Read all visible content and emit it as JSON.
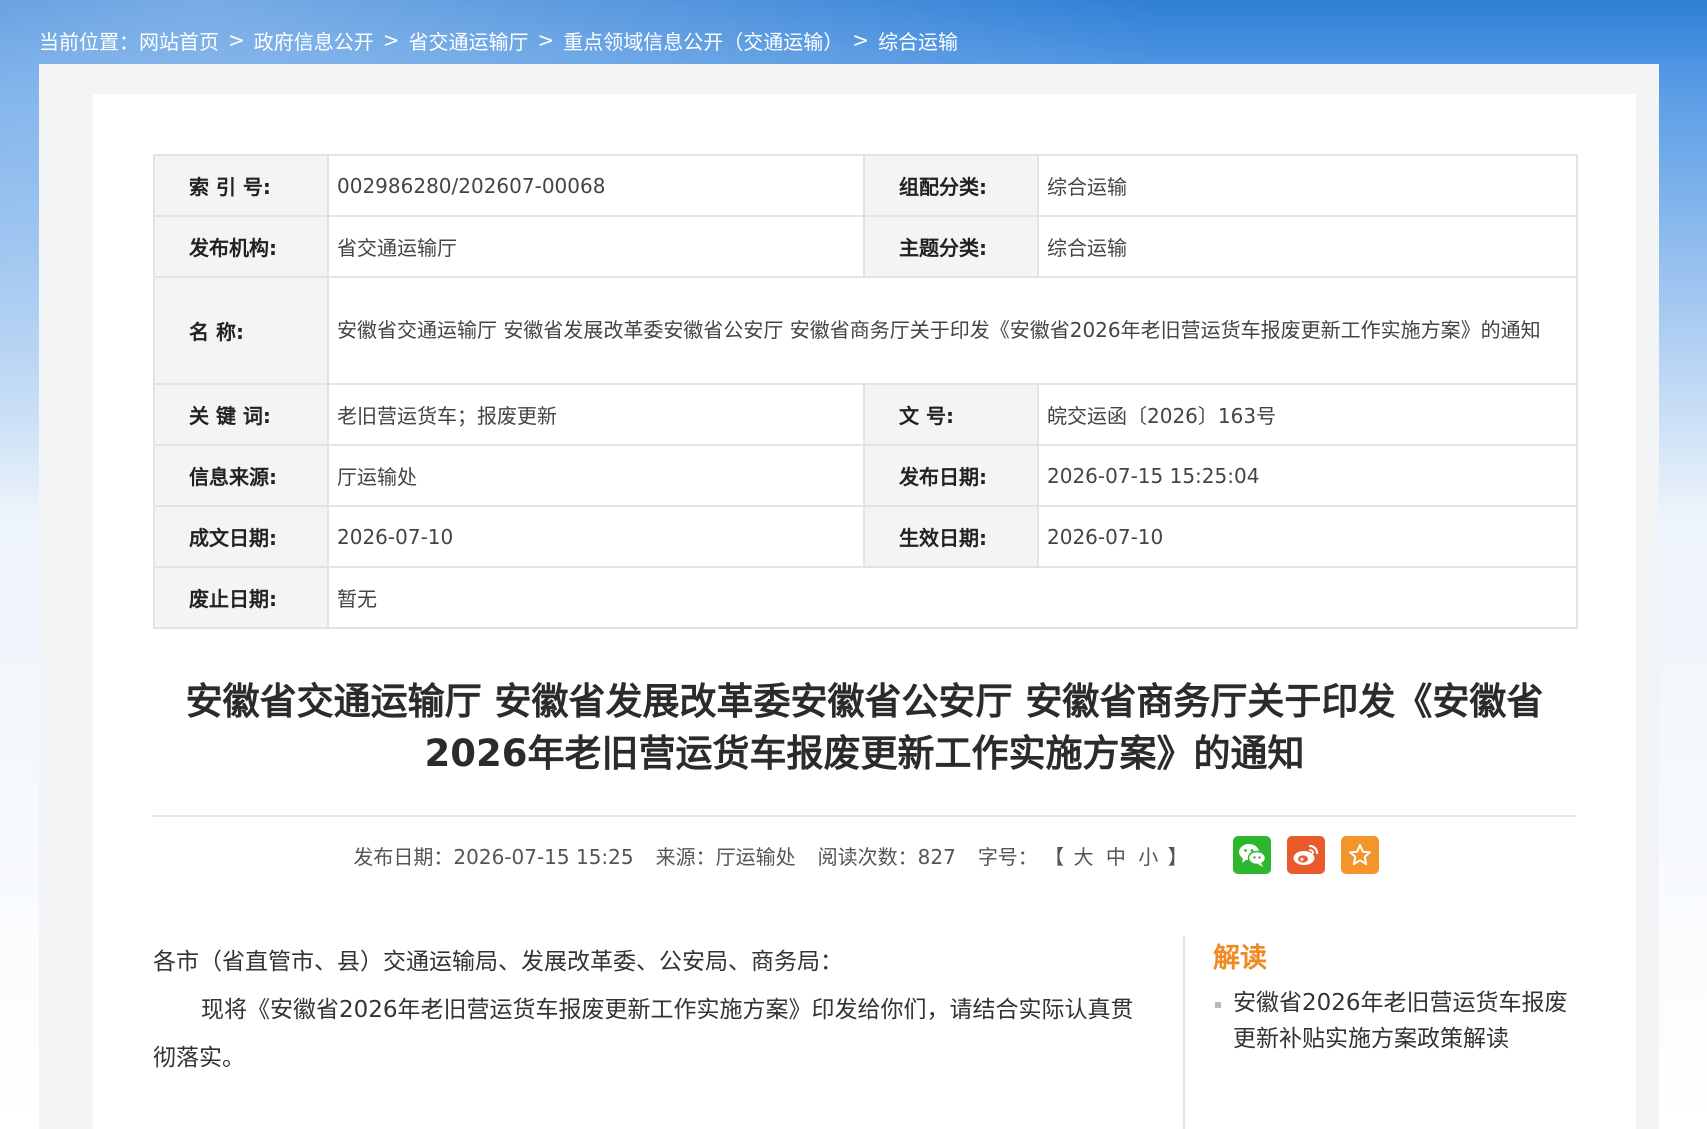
{
  "breadcrumb": {
    "prefix": "当前位置：",
    "items": [
      "网站首页",
      "政府信息公开",
      "省交通运输厅",
      "重点领域信息公开（交通运输）",
      "综合运输"
    ],
    "separator": ">"
  },
  "meta": {
    "index_no_label": "索 引 号:",
    "index_no": "002986280/202607-00068",
    "category_label": "组配分类:",
    "category": "综合运输",
    "publisher_label": "发布机构:",
    "publisher": "省交通运输厅",
    "topic_label": "主题分类:",
    "topic": "综合运输",
    "name_label": "名 称:",
    "name": "安徽省交通运输厅 安徽省发展改革委安徽省公安厅 安徽省商务厅关于印发《安徽省2026年老旧营运货车报废更新工作实施方案》的通知",
    "keywords_label": "关 键 词:",
    "keywords": "老旧营运货车；报废更新",
    "doc_no_label": "文 号:",
    "doc_no": "皖交运函〔2026〕163号",
    "source_label": "信息来源:",
    "source": "厅运输处",
    "pub_date_label": "发布日期:",
    "pub_date": "2026-07-15 15:25:04",
    "written_date_label": "成文日期:",
    "written_date": "2026-07-10",
    "effective_date_label": "生效日期:",
    "effective_date": "2026-07-10",
    "expiry_date_label": "废止日期:",
    "expiry_date": "暂无"
  },
  "article": {
    "title": "安徽省交通运输厅 安徽省发展改革委安徽省公安厅 安徽省商务厅关于印发《安徽省2026年老旧营运货车报废更新工作实施方案》的通知",
    "info": {
      "pub_date": "发布日期：2026-07-15 15:25",
      "source": "来源：厅运输处",
      "reads": "阅读次数：827",
      "font_size_label": "字号：",
      "fs_open": "【",
      "fs_large": "大",
      "fs_medium": "中",
      "fs_small": "小",
      "fs_close": "】"
    },
    "share_icons": [
      "wechat-icon",
      "weibo-icon",
      "favorite-star-icon"
    ],
    "salutation": "各市（省直管市、县）交通运输局、发展改革委、公安局、商务局：",
    "paragraph": "现将《安徽省2026年老旧营运货车报废更新工作实施方案》印发给你们，请结合实际认真贯彻落实。"
  },
  "sidebar": {
    "heading": "解读",
    "items": [
      "安徽省2026年老旧营运货车报废更新补贴实施方案政策解读"
    ]
  },
  "colors": {
    "header_blue": "#2f7fd6",
    "accent_orange": "#f08a24",
    "wechat_green": "#2fb62f",
    "weibo_red": "#ea5a2b",
    "favorite_orange": "#f2962a"
  }
}
